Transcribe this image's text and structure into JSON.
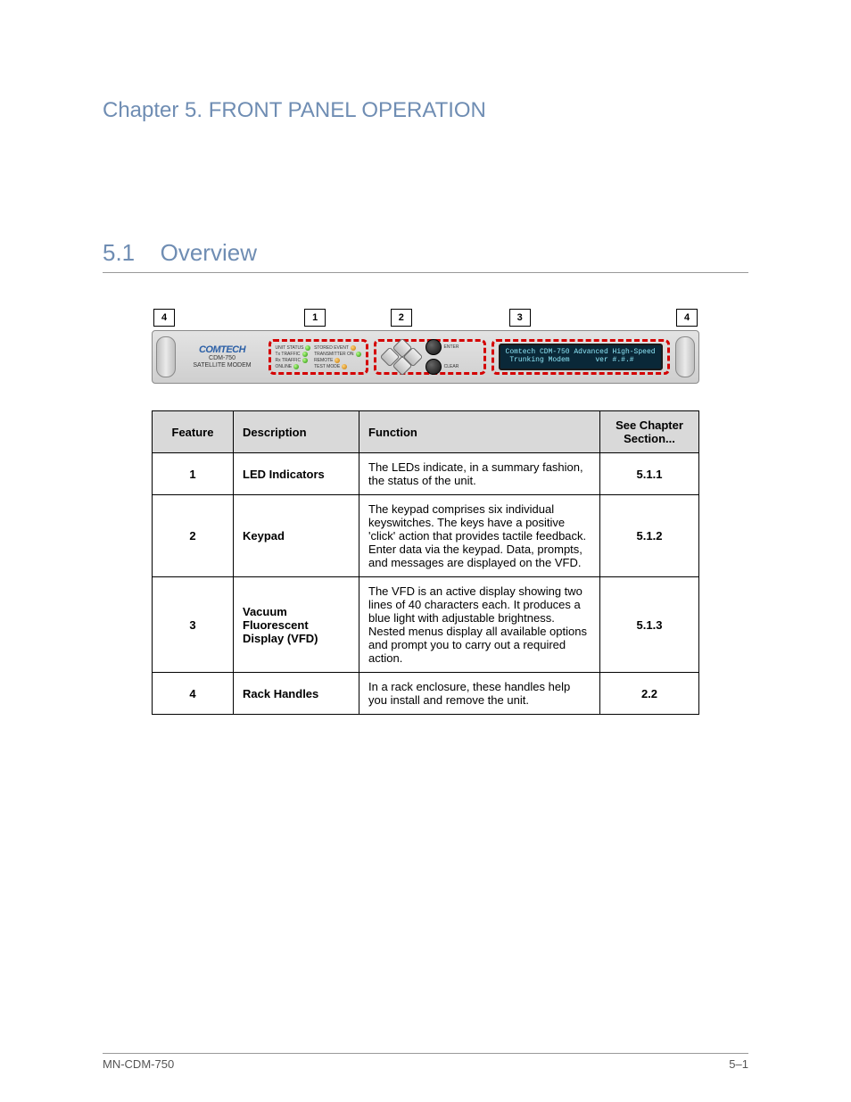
{
  "chapter_label": "Chapter 5. FRONT PANEL OPERATION",
  "section_number": "5.1",
  "section_title": "Overview",
  "device": {
    "brand": "COMTECH",
    "model": "CDM-750",
    "subtitle": "SATELLITE MODEM",
    "vfd_line1": "Comtech CDM-750 Advanced High-Speed",
    "vfd_line2": " Trunking Modem      ver #.#.#",
    "callouts": {
      "left_outer": "4",
      "c1": "1",
      "c2": "2",
      "c3": "3",
      "right_outer": "4"
    },
    "leds": {
      "l1": "UNIT STATUS",
      "r1": "STORED EVENT",
      "l2": "Tx TRAFFIC",
      "r2": "TRANSMITTER ON",
      "l3": "Rx TRAFFIC",
      "r3": "REMOTE",
      "l4": "ONLINE",
      "r4": "TEST MODE"
    },
    "keypad": {
      "enter": "ENTER",
      "clear": "CLEAR"
    }
  },
  "table": {
    "headers": {
      "feature": "Feature",
      "description": "Description",
      "function": "Function",
      "see": "See Chapter Section..."
    },
    "rows": [
      {
        "n": "1",
        "desc": "LED Indicators",
        "func": "The LEDs indicate, in a summary fashion, the status of the unit.",
        "see": "5.1.1"
      },
      {
        "n": "2",
        "desc": "Keypad",
        "func": "The keypad comprises six individual keyswitches. The keys have a positive 'click' action that provides tactile feedback. Enter data via the keypad. Data, prompts, and messages are displayed on the VFD.",
        "see": "5.1.2"
      },
      {
        "n": "3",
        "desc": "Vacuum Fluorescent Display (VFD)",
        "func": "The VFD is an active display showing two lines of 40 characters each. It produces a blue light with adjustable brightness. Nested menus display all available options and prompt you to carry out a required action.",
        "see": "5.1.3"
      },
      {
        "n": "4",
        "desc": "Rack Handles",
        "func": "In a rack enclosure, these handles help you install and remove the unit.",
        "see": "2.2"
      }
    ]
  },
  "footer": {
    "doc": "MN-CDM-750",
    "page": "5–1"
  }
}
